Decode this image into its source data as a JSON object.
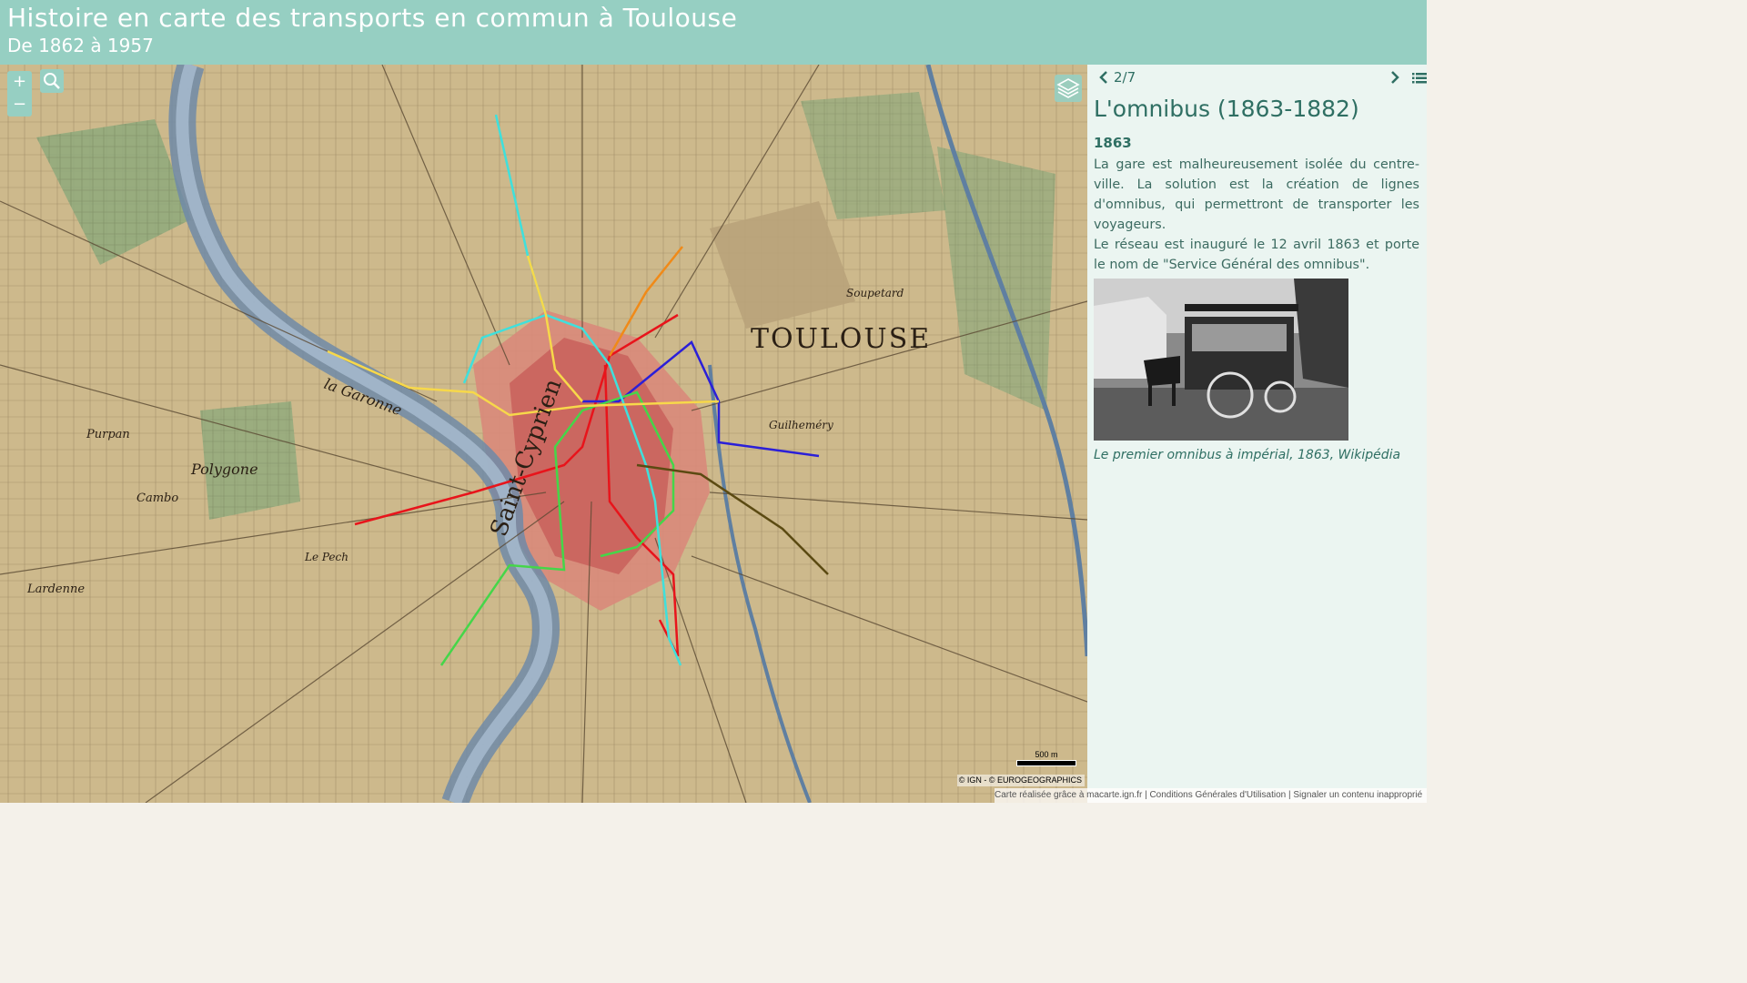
{
  "header": {
    "title": "Histoire en carte des transports en commun à Toulouse",
    "subtitle": "De 1862 à 1957"
  },
  "map_controls": {
    "zoom_in": "+",
    "zoom_out": "−",
    "search_icon": "search-icon",
    "layers_icon": "layers-icon"
  },
  "map": {
    "labels": [
      "TOULOUSE",
      "la Garonne",
      "Polygone",
      "Cambo",
      "Purpan",
      "Lardenne",
      "Guilheméry",
      "Soupetard",
      "Le Pech",
      "Saint-Cyprien"
    ],
    "line_colors": [
      "#e8141b",
      "#2b1fd8",
      "#45d649",
      "#3fe0dc",
      "#f7d84a",
      "#f08a18",
      "#d8efb0"
    ],
    "scale_label": "500 m",
    "attribution": "© IGN - © EUROGEOGRAPHICS"
  },
  "footer": {
    "text": "Carte réalisée grâce à macarte.ign.fr | Conditions Générales d'Utilisation | Signaler un contenu inapproprié"
  },
  "panel": {
    "page_indicator": "2/7",
    "title": "L'omnibus (1863-1882)",
    "year": "1863",
    "paragraph1": "La gare est malheureusement isolée du centre-ville. La solution est la création de lignes d'omnibus, qui permettront de transporter les voyageurs.",
    "paragraph2": "Le réseau est inauguré le 12 avril 1863 et porte le nom de \"Service Général des omnibus\".",
    "caption": "Le premier omnibus à impérial, 1863, Wikipédia"
  },
  "colors": {
    "header_bg": "#96cfc2",
    "panel_bg": "#ebf5f1",
    "accent_text": "#2f6f63"
  }
}
